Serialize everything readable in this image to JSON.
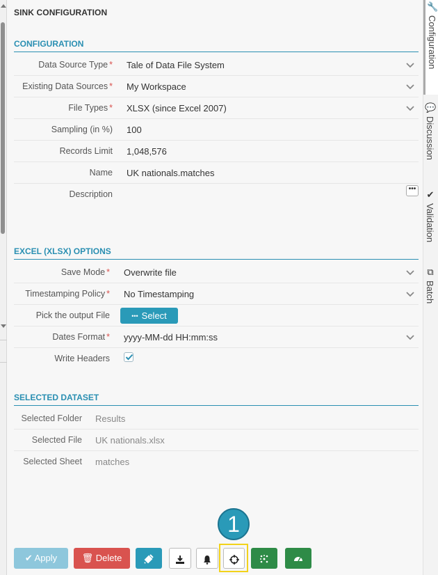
{
  "panel_title": "SINK CONFIGURATION",
  "configuration": {
    "title": "CONFIGURATION",
    "rows": [
      {
        "label": "Data Source Type",
        "required": "*",
        "value": "Tale of Data File System"
      },
      {
        "label": "Existing Data Sources",
        "required": "*",
        "value": "My Workspace"
      },
      {
        "label": "File Types",
        "required": "*",
        "value": "XLSX (since Excel 2007)"
      },
      {
        "label": "Sampling (in %)",
        "value": "100"
      },
      {
        "label": "Records Limit",
        "value": "1,048,576"
      },
      {
        "label": "Name",
        "value": "UK nationals.matches"
      },
      {
        "label": "Description",
        "value": ""
      }
    ],
    "description_more_label": "•••"
  },
  "excel_options": {
    "title": "EXCEL (XLSX) OPTIONS",
    "rows": [
      {
        "label": "Save Mode",
        "required": "*",
        "value": "Overwrite file"
      },
      {
        "label": "Timestamping Policy",
        "required": "*",
        "value": "No Timestamping"
      },
      {
        "label": "Pick the output File",
        "button_label": "Select",
        "button_icon": "•••"
      },
      {
        "label": "Dates Format",
        "required": "*",
        "value": "yyyy-MM-dd HH:mm:ss"
      },
      {
        "label": "Write Headers",
        "checked": true
      }
    ]
  },
  "selected_dataset": {
    "title": "SELECTED DATASET",
    "rows": [
      {
        "label": "Selected Folder",
        "value": "Results"
      },
      {
        "label": "Selected File",
        "value": "UK nationals.xlsx"
      },
      {
        "label": "Selected Sheet",
        "value": "matches"
      }
    ]
  },
  "right_tabs": [
    {
      "label": "Configuration",
      "icon": "wrench-icon",
      "active": true
    },
    {
      "label": "Discussion",
      "icon": "comments-icon"
    },
    {
      "label": "Validation",
      "icon": "check-icon"
    },
    {
      "label": "Batch",
      "icon": "copy-icon"
    }
  ],
  "toolbar": {
    "apply_label": "Apply",
    "delete_label": "Delete",
    "icons": [
      "plug-icon",
      "download-icon",
      "bell-icon",
      "crosshair-icon",
      "asterisk-icon",
      "gauge-icon"
    ]
  },
  "step_marker": "1",
  "colors": {
    "accent": "#2a8fb2",
    "danger": "#d9534f",
    "success": "#2e8b47",
    "highlight": "#f2d21b"
  }
}
